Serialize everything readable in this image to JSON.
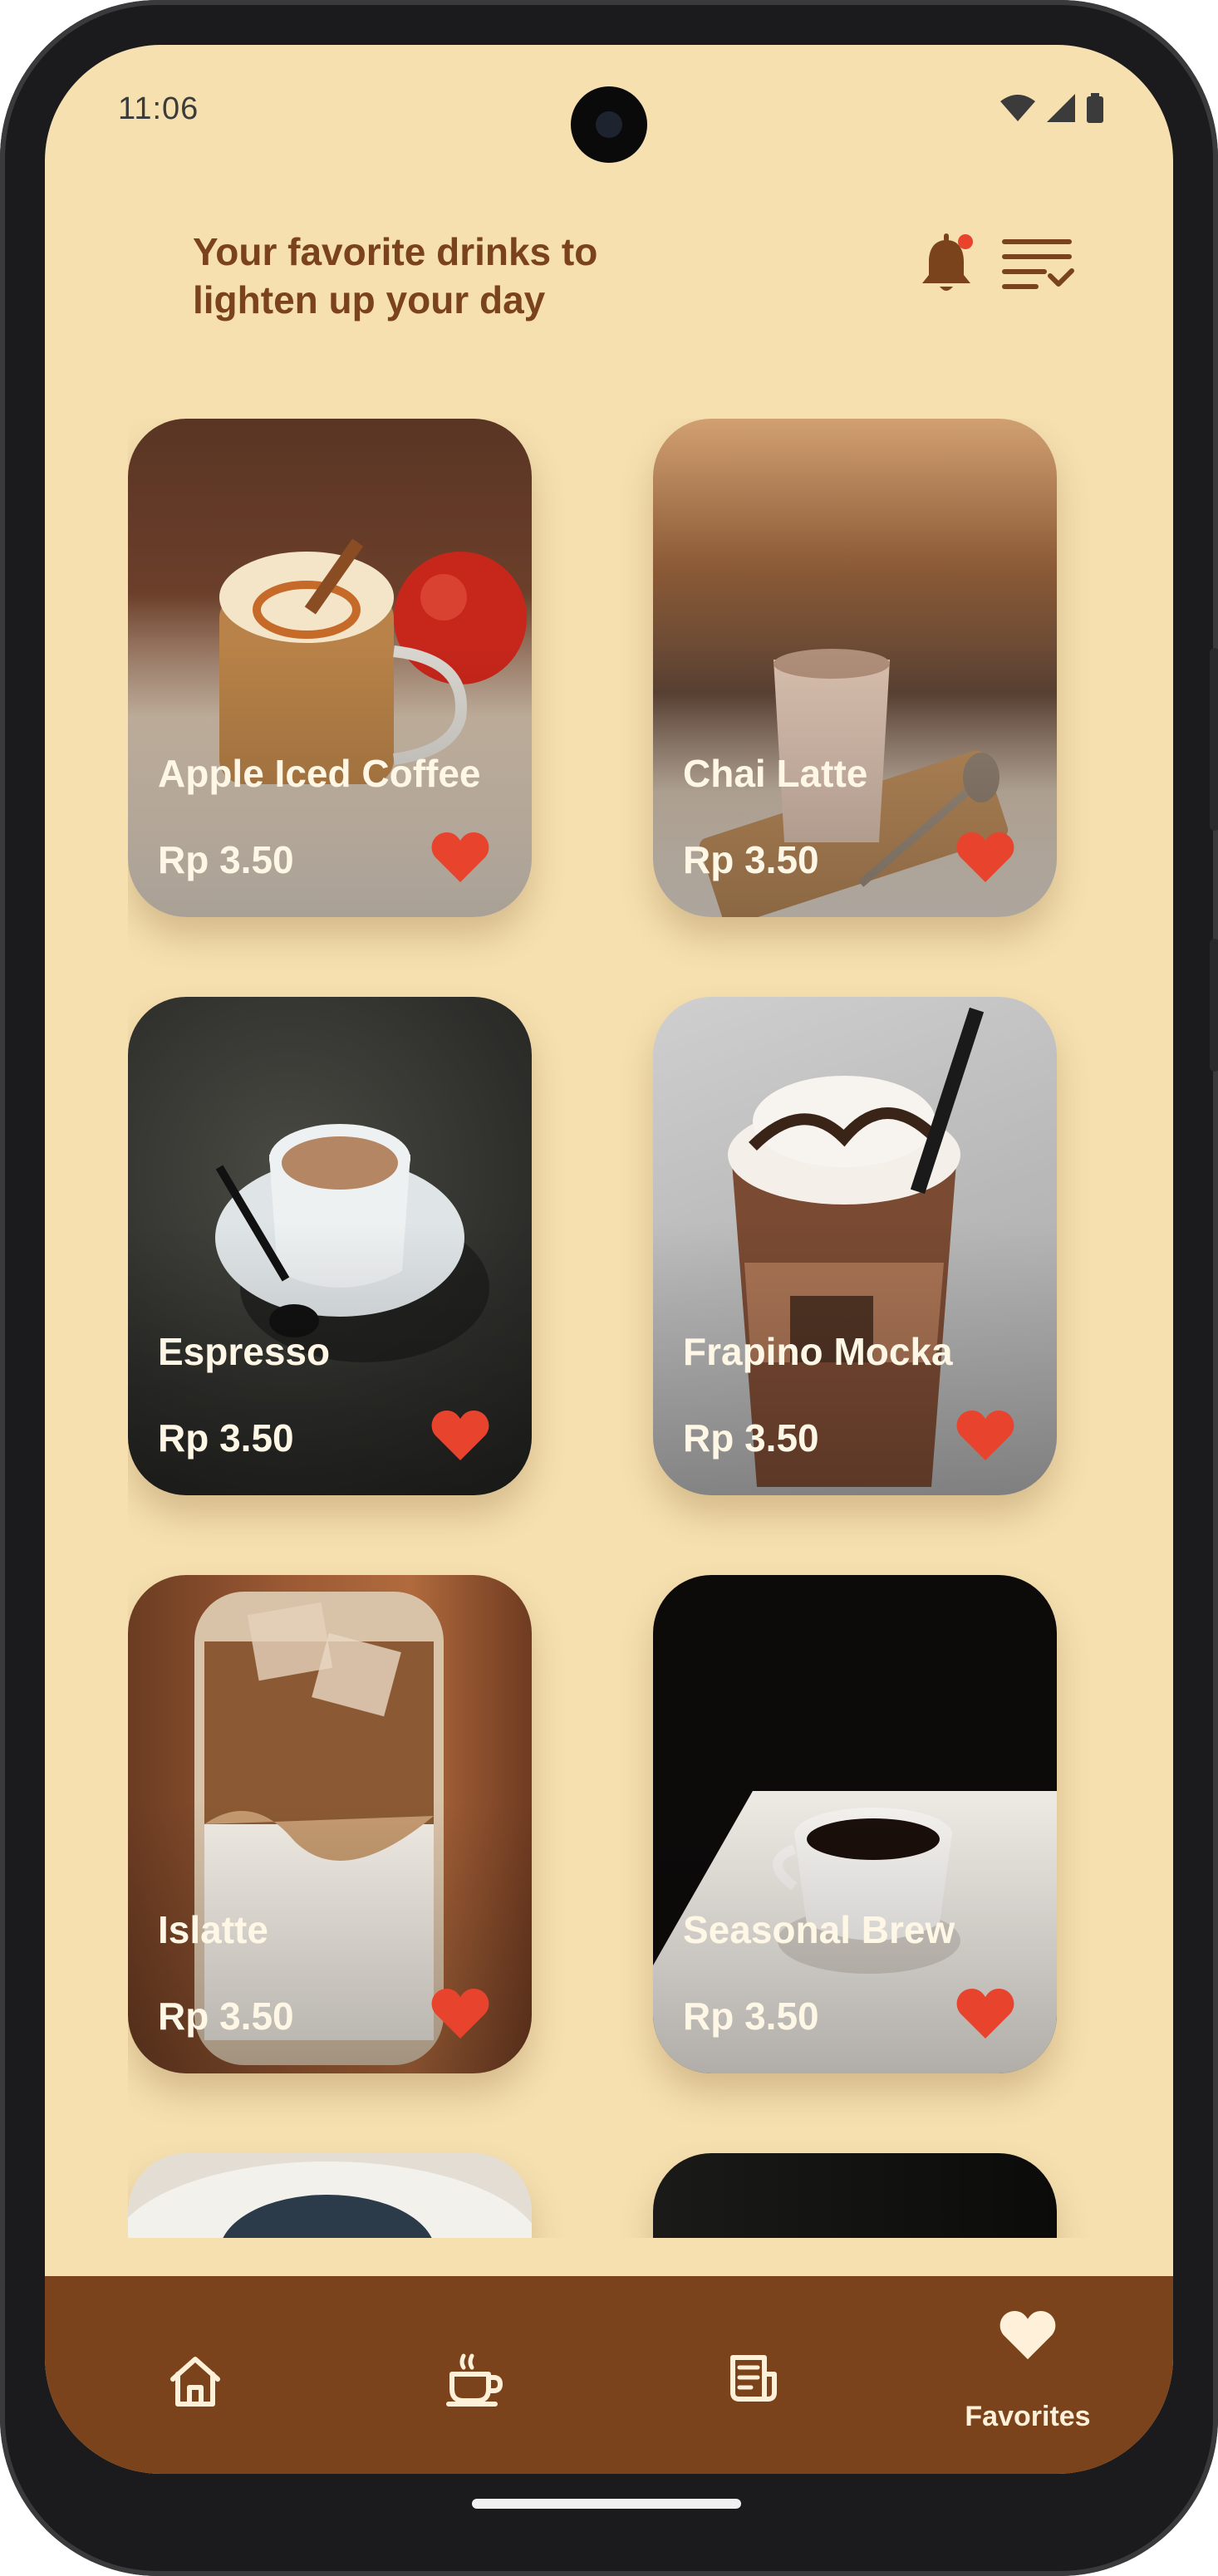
{
  "status_bar": {
    "time": "11:06"
  },
  "header": {
    "title": "Your favorite drinks to lighten up your day"
  },
  "colors": {
    "background": "#f6e0b0",
    "brand_brown": "#7a431b",
    "heart_red": "#e8432d",
    "text_light": "#fff7e6"
  },
  "drinks": [
    {
      "name": "Apple Iced Coffee",
      "price": "Rp 3.50",
      "favorite": true
    },
    {
      "name": "Chai Latte",
      "price": "Rp 3.50",
      "favorite": true
    },
    {
      "name": "Espresso",
      "price": "Rp 3.50",
      "favorite": true
    },
    {
      "name": "Frapino Mocka",
      "price": "Rp 3.50",
      "favorite": true
    },
    {
      "name": "Islatte",
      "price": "Rp 3.50",
      "favorite": true
    },
    {
      "name": "Seasonal Brew",
      "price": "Rp 3.50",
      "favorite": true
    }
  ],
  "bottom_nav": {
    "items": [
      {
        "icon": "home-icon",
        "label": ""
      },
      {
        "icon": "coffee-cup-icon",
        "label": ""
      },
      {
        "icon": "receipt-icon",
        "label": ""
      },
      {
        "icon": "heart-icon",
        "label": "Favorites",
        "active": true
      }
    ]
  }
}
